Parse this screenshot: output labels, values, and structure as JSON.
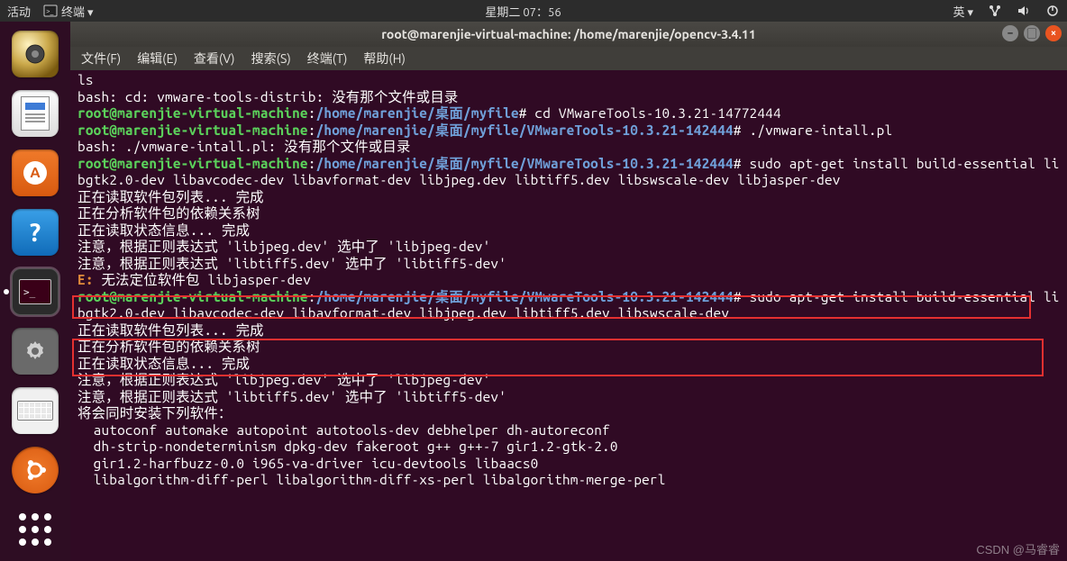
{
  "panel": {
    "activities": "活动",
    "app_indicator": "终端 ▾",
    "clock": "星期二 07：56",
    "ime": "英 ▾"
  },
  "window": {
    "title": "root@marenjie-virtual-machine: /home/marenjie/opencv-3.4.11",
    "menu": {
      "file": "文件(F)",
      "edit": "编辑(E)",
      "view": "查看(V)",
      "search": "搜索(S)",
      "terminal": "终端(T)",
      "help": "帮助(H)"
    }
  },
  "prompts": {
    "desk": {
      "user": "root@marenjie-virtual-machine",
      "path": "/home/marenjie/桌面/myfile",
      "hash": "#"
    },
    "vmt": {
      "user": "root@marenjie-virtual-machine",
      "path": "/home/marenjie/桌面/myfile/VMwareTools-10.3.21-142444",
      "hash": "#"
    }
  },
  "term": {
    "l0": "ls",
    "l1": "bash: cd: vmware-tools-distrib: 没有那个文件或目录",
    "cmd_cd": " cd VMwareTools-10.3.21-14772444",
    "cmd_run": " ./vmware-intall.pl",
    "l_norun": "bash: ./vmware-intall.pl: 没有那个文件或目录",
    "cmd_apt1": " sudo apt-get install build-essential libgtk2.0-dev libavcodec-dev libavformat-dev libjpeg.dev libtiff5.dev libswscale-dev libjasper-dev",
    "pkg_read": "正在读取软件包列表... 完成",
    "pkg_tree": "正在分析软件包的依赖关系树",
    "pkg_state": "正在读取状态信息... 完成",
    "note_jpeg": "注意，根据正则表达式 'libjpeg.dev' 选中了 'libjpeg-dev'",
    "note_tiff": "注意，根据正则表达式 'libtiff5.dev' 选中了 'libtiff5-dev'",
    "err_label": "E: ",
    "err_msg": "无法定位软件包 libjasper-dev",
    "cmd_apt2": " sudo apt-get install build-essential libgtk2.0-dev libavcodec-dev libavformat-dev libjpeg.dev libtiff5.dev libswscale-dev",
    "also_install": "将会同时安装下列软件：",
    "dep1": "  autoconf automake autopoint autotools-dev debhelper dh-autoreconf",
    "dep2": "  dh-strip-nondeterminism dpkg-dev fakeroot g++ g++-7 gir1.2-gtk-2.0",
    "dep3": "  gir1.2-harfbuzz-0.0 i965-va-driver icu-devtools libaacs0",
    "dep4": "  libalgorithm-diff-perl libalgorithm-diff-xs-perl libalgorithm-merge-perl"
  },
  "watermark": "CSDN @马睿睿"
}
